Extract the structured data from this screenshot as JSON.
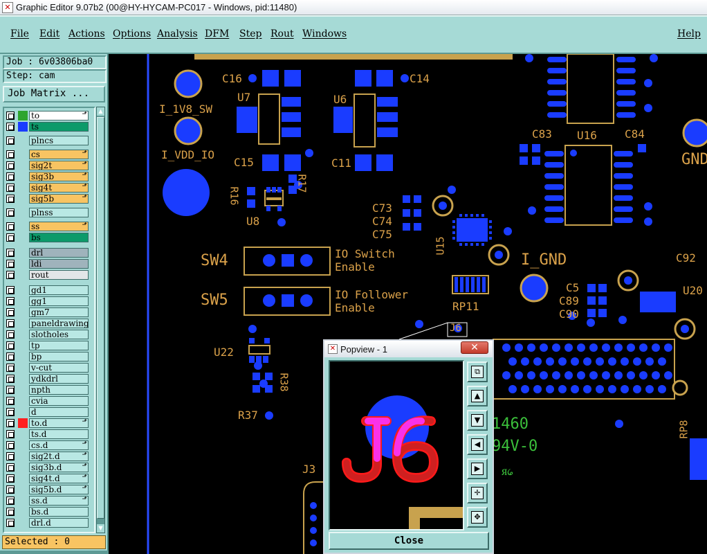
{
  "window": {
    "title": "Graphic Editor 9.07b2 (00@HY-HYCAM-PC017 - Windows, pid:11480)"
  },
  "menu": [
    "File",
    "Edit",
    "Actions",
    "Options",
    "Analysis",
    "DFM",
    "Step",
    "Rout",
    "Windows"
  ],
  "help": "Help",
  "job": "Job : 6v03806ba0",
  "step": "Step: cam",
  "job_matrix": "Job Matrix ...",
  "layers": [
    {
      "name": "to",
      "swatch": "#2ea52e",
      "bg": "#ffffff",
      "lock": true
    },
    {
      "name": "ts",
      "swatch": "#1a3cff",
      "bg": "#0c9a6a",
      "lock": false
    },
    {
      "name": "plncs",
      "swatch": "",
      "bg": "#b9e8e4",
      "lock": false
    },
    {
      "name": "cs",
      "swatch": "",
      "bg": "#f8c462",
      "lock": true
    },
    {
      "name": "sig2t",
      "swatch": "",
      "bg": "#f8c462",
      "lock": true
    },
    {
      "name": "sig3b",
      "swatch": "",
      "bg": "#f8c462",
      "lock": true
    },
    {
      "name": "sig4t",
      "swatch": "",
      "bg": "#f8c462",
      "lock": true
    },
    {
      "name": "sig5b",
      "swatch": "",
      "bg": "#f8c462",
      "lock": true
    },
    {
      "name": "plnss",
      "swatch": "",
      "bg": "#b9e8e4",
      "lock": false
    },
    {
      "name": "ss",
      "swatch": "",
      "bg": "#f8c462",
      "lock": true
    },
    {
      "name": "bs",
      "swatch": "",
      "bg": "#0c9a6a",
      "lock": false
    },
    {
      "name": "drl",
      "swatch": "",
      "bg": "#9fb3bc",
      "lock": false
    },
    {
      "name": "ldi",
      "swatch": "",
      "bg": "#9fb3bc",
      "lock": false
    },
    {
      "name": "rout",
      "swatch": "",
      "bg": "#e2e6e8",
      "lock": false
    },
    {
      "name": "gd1",
      "swatch": "",
      "bg": "#b9e8e4",
      "lock": false
    },
    {
      "name": "gg1",
      "swatch": "",
      "bg": "#b9e8e4",
      "lock": false
    },
    {
      "name": "gm7",
      "swatch": "",
      "bg": "#b9e8e4",
      "lock": false
    },
    {
      "name": "paneldrawing",
      "swatch": "",
      "bg": "#b9e8e4",
      "lock": false
    },
    {
      "name": "slotholes",
      "swatch": "",
      "bg": "#b9e8e4",
      "lock": false
    },
    {
      "name": "tp",
      "swatch": "",
      "bg": "#b9e8e4",
      "lock": false
    },
    {
      "name": "bp",
      "swatch": "",
      "bg": "#b9e8e4",
      "lock": false
    },
    {
      "name": "v-cut",
      "swatch": "",
      "bg": "#b9e8e4",
      "lock": false
    },
    {
      "name": "ydkdrl",
      "swatch": "",
      "bg": "#b9e8e4",
      "lock": false
    },
    {
      "name": "npth",
      "swatch": "",
      "bg": "#b9e8e4",
      "lock": false
    },
    {
      "name": "cvia",
      "swatch": "",
      "bg": "#b9e8e4",
      "lock": false
    },
    {
      "name": "d",
      "swatch": "",
      "bg": "#b9e8e4",
      "lock": false
    },
    {
      "name": "to.d",
      "swatch": "#ff2020",
      "bg": "#b9e8e4",
      "lock": true
    },
    {
      "name": "ts.d",
      "swatch": "",
      "bg": "#b9e8e4",
      "lock": false
    },
    {
      "name": "cs.d",
      "swatch": "",
      "bg": "#b9e8e4",
      "lock": true
    },
    {
      "name": "sig2t.d",
      "swatch": "",
      "bg": "#b9e8e4",
      "lock": true
    },
    {
      "name": "sig3b.d",
      "swatch": "",
      "bg": "#b9e8e4",
      "lock": true
    },
    {
      "name": "sig4t.d",
      "swatch": "",
      "bg": "#b9e8e4",
      "lock": true
    },
    {
      "name": "sig5b.d",
      "swatch": "",
      "bg": "#b9e8e4",
      "lock": true
    },
    {
      "name": "ss.d",
      "swatch": "",
      "bg": "#b9e8e4",
      "lock": true
    },
    {
      "name": "bs.d",
      "swatch": "",
      "bg": "#b9e8e4",
      "lock": false
    },
    {
      "name": "drl.d",
      "swatch": "",
      "bg": "#b9e8e4",
      "lock": false
    }
  ],
  "selected": "Selected : 0",
  "pcb_labels": {
    "c16": "C16",
    "c14": "C14",
    "u7": "U7",
    "u6": "U6",
    "i1v8": "I_1V8_SW",
    "ivdd": "I_VDD_IO",
    "c15": "C15",
    "c11": "C11",
    "r16": "R16",
    "r17": "R17",
    "u8": "U8",
    "c73": "C73",
    "c74": "C74",
    "c75": "C75",
    "u15": "U15",
    "c83": "C83",
    "u16": "U16",
    "c84": "C84",
    "gnd": "GND",
    "sw4": "SW4",
    "sw5": "SW5",
    "io_sw1": "IO Switch",
    "io_sw2": "Enable",
    "io_fo1": "IO Follower",
    "io_fo2": "Enable",
    "i_gnd": "I_GND",
    "c92": "C92",
    "c5": "C5",
    "c89": "C89",
    "c90": "C90",
    "u20": "U20",
    "rp11": "RP11",
    "j6": "J6",
    "u22": "U22",
    "r38": "R38",
    "r37": "R37",
    "j3": "J3",
    "rp8": "RP8"
  },
  "silk_green": {
    "line1": "1460",
    "line2": "94V-0"
  },
  "popview": {
    "title": "Popview - 1",
    "close_x": "✕",
    "close_label": "Close",
    "tools": [
      "zoom-fit",
      "pan-up",
      "pan-down",
      "pan-left",
      "pan-right",
      "zoom-in",
      "zoom-out"
    ]
  },
  "colors": {
    "panel": "#a6dad6",
    "pad": "#1a3cff",
    "silk": "#dba24a",
    "outline": "#c8a24e"
  }
}
